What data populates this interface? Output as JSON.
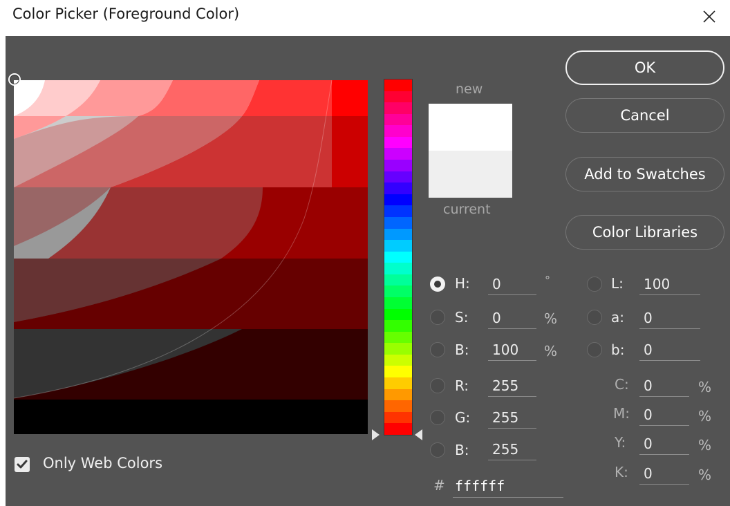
{
  "window": {
    "title": "Color Picker (Foreground Color)",
    "close_icon": "close-icon"
  },
  "preview": {
    "new_label": "new",
    "current_label": "current",
    "new_color": "#ffffff",
    "current_color": "#efefef"
  },
  "buttons": {
    "ok": "OK",
    "cancel": "Cancel",
    "add_swatches": "Add to Swatches",
    "color_libraries": "Color Libraries"
  },
  "hsb": {
    "h": {
      "label": "H:",
      "value": "0",
      "unit": "°",
      "selected": true
    },
    "s": {
      "label": "S:",
      "value": "0",
      "unit": "%"
    },
    "b": {
      "label": "B:",
      "value": "100",
      "unit": "%"
    }
  },
  "rgb": {
    "r": {
      "label": "R:",
      "value": "255"
    },
    "g": {
      "label": "G:",
      "value": "255"
    },
    "b": {
      "label": "B:",
      "value": "255"
    }
  },
  "lab": {
    "l": {
      "label": "L:",
      "value": "100"
    },
    "a": {
      "label": "a:",
      "value": "0"
    },
    "b": {
      "label": "b:",
      "value": "0"
    }
  },
  "cmyk": {
    "c": {
      "label": "C:",
      "value": "0",
      "unit": "%"
    },
    "m": {
      "label": "M:",
      "value": "0",
      "unit": "%"
    },
    "y": {
      "label": "Y:",
      "value": "0",
      "unit": "%"
    },
    "k": {
      "label": "K:",
      "value": "0",
      "unit": "%"
    }
  },
  "hex": {
    "symbol": "#",
    "value": "ffffff"
  },
  "options": {
    "only_web_colors": {
      "label": "Only Web Colors",
      "checked": true
    }
  },
  "colors": {
    "dialog_bg": "#535353",
    "hue_top": "#ff0000"
  }
}
